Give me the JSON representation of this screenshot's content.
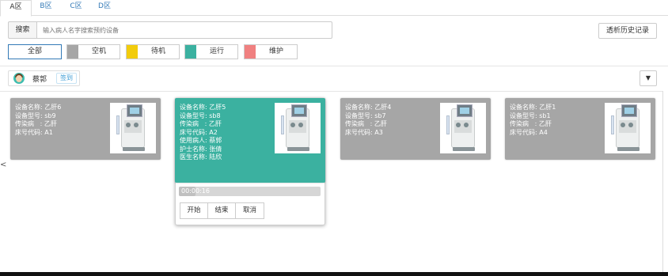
{
  "tabs": [
    "A区",
    "B区",
    "C区",
    "D区"
  ],
  "search": {
    "label": "搜索",
    "placeholder": "输入病人名字搜索预约设备"
  },
  "history_button": "透析历史记录",
  "filters": {
    "all": "全部",
    "items": [
      {
        "label": "空机",
        "color": "#a6a6a6"
      },
      {
        "label": "待机",
        "color": "#f2cc0c"
      },
      {
        "label": "运行",
        "color": "#3bb1a0"
      },
      {
        "label": "维护",
        "color": "#f08080"
      }
    ]
  },
  "user": {
    "name": "蔡郭",
    "checkin": "签到"
  },
  "dropdown_icon": "▼",
  "left_arrow": "<",
  "cards": [
    {
      "lines": [
        "设备名称: 乙肝6",
        "设备型号: sb9",
        "传染病   : 乙肝",
        "床号代码: A1"
      ]
    },
    {
      "lines": [
        "设备名称: 乙肝5",
        "设备型号: sb8",
        "传染病   : 乙肝",
        "床号代码: A2",
        "使用病人: 蔡郭",
        "护士名称: 张倩",
        "医生名称: 陆欣"
      ]
    },
    {
      "lines": [
        "设备名称: 乙肝4",
        "设备型号: sb7",
        "传染病   : 乙肝",
        "床号代码: A3"
      ]
    },
    {
      "lines": [
        "设备名称: 乙肝1",
        "设备型号: sb1",
        "传染病   : 乙肝",
        "床号代码: A4"
      ]
    }
  ],
  "running": {
    "timer": "00:00:16",
    "progress": 0.12
  },
  "actions": {
    "start": "开始",
    "end": "结束",
    "cancel": "取消"
  }
}
